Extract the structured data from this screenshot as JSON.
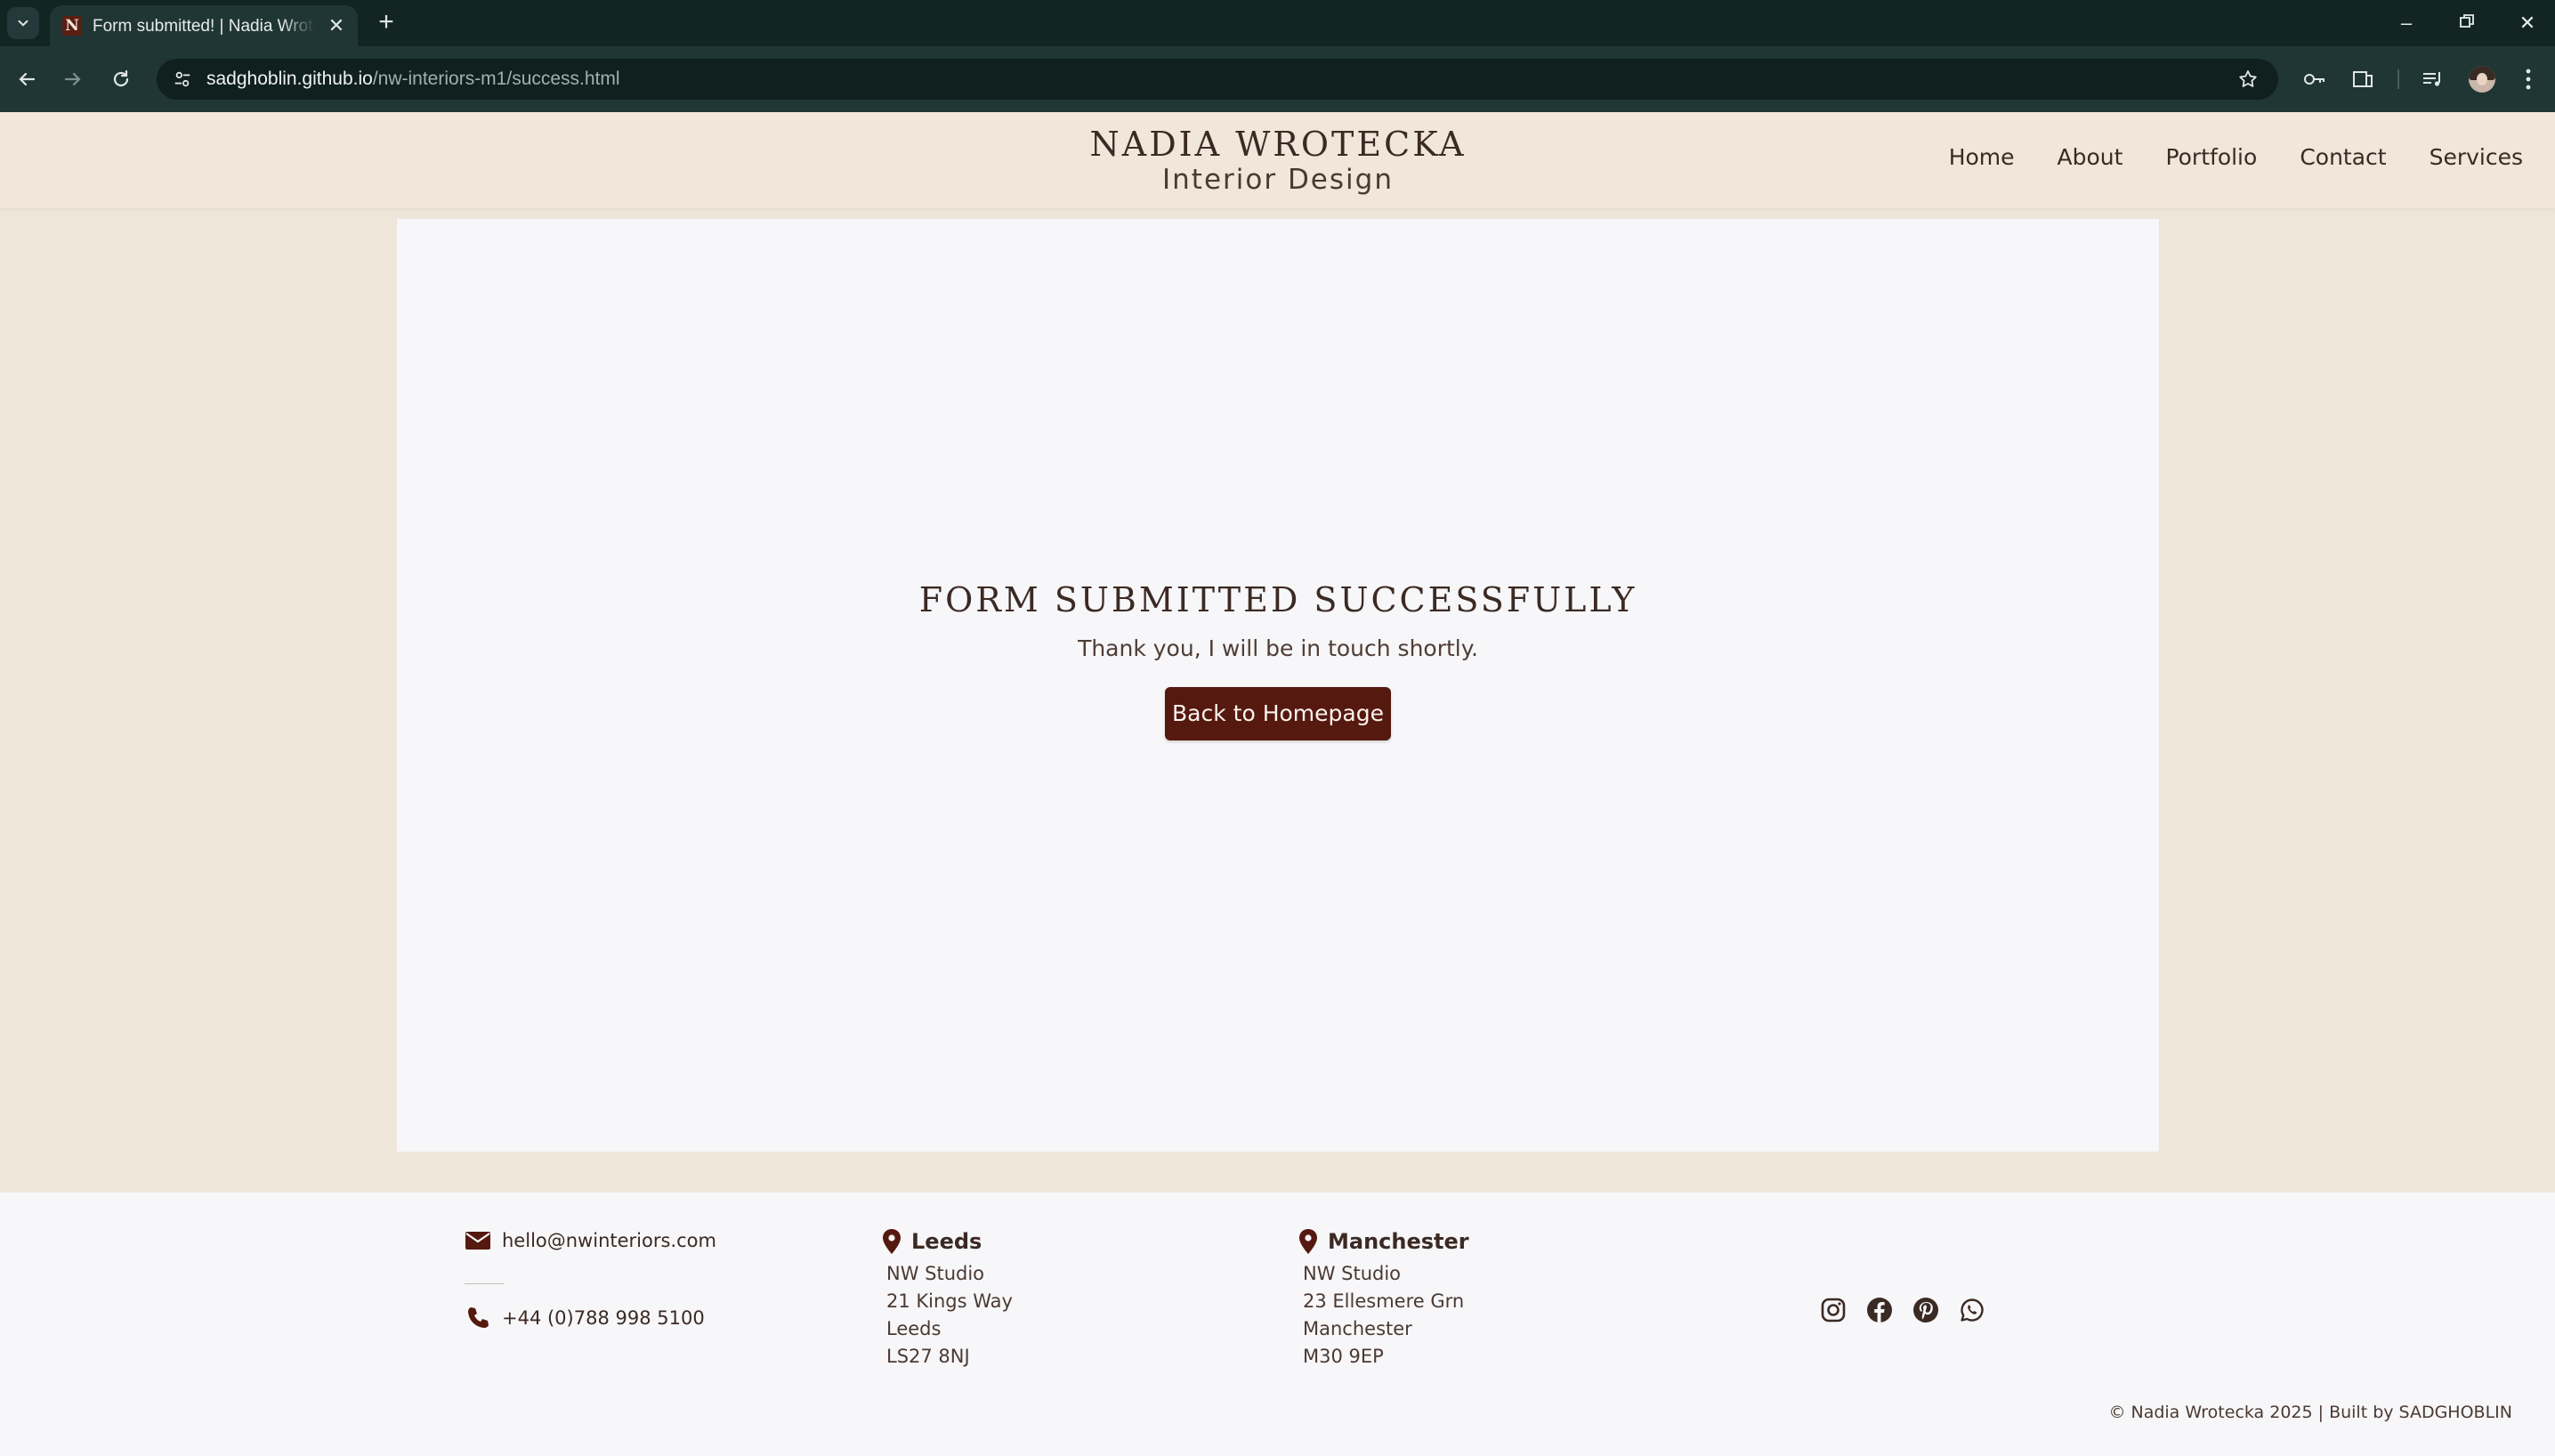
{
  "browser": {
    "tab_title": "Form submitted! | Nadia Wrotecka",
    "favicon_letter": "N",
    "url_host": "sadghoblin.github.io",
    "url_path": "/nw-interiors-m1/success.html"
  },
  "header": {
    "brand_name": "NADIA WROTECKA",
    "brand_sub": "Interior Design",
    "nav": [
      "Home",
      "About",
      "Portfolio",
      "Contact",
      "Services"
    ]
  },
  "main": {
    "title": "FORM SUBMITTED SUCCESSFULLY",
    "message": "Thank you, I will be in touch shortly.",
    "button_label": "Back to Homepage"
  },
  "footer": {
    "email": "hello@nwinteriors.com",
    "phone": "+44 (0)788 998 5100",
    "locations": [
      {
        "city": "Leeds",
        "lines": [
          "NW Studio",
          "21 Kings Way",
          "Leeds",
          "LS27 8NJ"
        ]
      },
      {
        "city": "Manchester",
        "lines": [
          "NW Studio",
          "23 Ellesmere Grn",
          "Manchester",
          "M30 9EP"
        ]
      }
    ],
    "social_icons": [
      "instagram-icon",
      "facebook-icon",
      "pinterest-icon",
      "whatsapp-icon"
    ],
    "copyright": "© Nadia Wrotecka 2025  |  Built by SADGHOBLIN"
  },
  "colors": {
    "accent": "#55190f",
    "page_bg": "#efe6da",
    "card_bg": "#f7f6f9",
    "chrome_dark": "#132523"
  }
}
